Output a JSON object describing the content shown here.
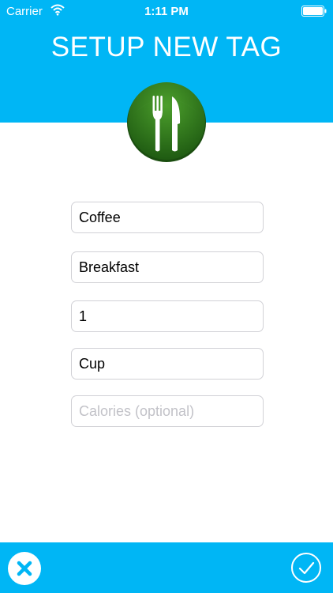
{
  "status_bar": {
    "carrier": "Carrier",
    "time": "1:11 PM",
    "wifi_icon": "wifi-icon",
    "battery_icon": "battery-icon"
  },
  "header": {
    "title": "SETUP NEW TAG",
    "tag_icon": "fork-knife-icon",
    "tag_icon_color": "#2e7d1f"
  },
  "form": {
    "name": {
      "value": "Coffee",
      "placeholder": ""
    },
    "meal": {
      "value": "Breakfast",
      "placeholder": ""
    },
    "quantity": {
      "value": "1",
      "placeholder": ""
    },
    "unit": {
      "value": "Cup",
      "placeholder": ""
    },
    "calories": {
      "value": "",
      "placeholder": "Calories (optional)"
    }
  },
  "footer": {
    "cancel_icon": "close-icon",
    "confirm_icon": "checkmark-icon"
  },
  "colors": {
    "accent": "#00b6f5",
    "field_border": "#d1d1d6",
    "placeholder": "#c2c2c8"
  }
}
